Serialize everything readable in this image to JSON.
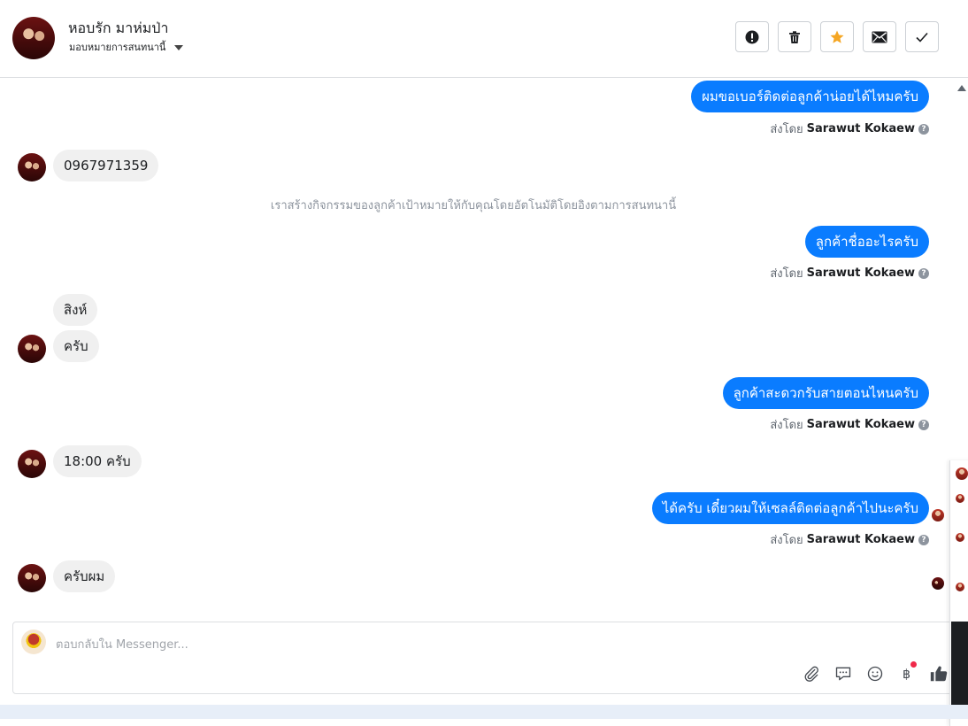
{
  "header": {
    "contact_name": "หอบรัก มาห่มป่า",
    "assign_label": "มอบหมายการสนทนานี้",
    "actions": [
      {
        "icon": "exclamation-icon"
      },
      {
        "icon": "trash-icon"
      },
      {
        "icon": "star-icon",
        "color": "#f5a623"
      },
      {
        "icon": "envelope-icon"
      },
      {
        "icon": "check-icon"
      }
    ]
  },
  "sent_by_prefix": "ส่งโดย",
  "agent_name": "Sarawut Kokaew",
  "messages": [
    {
      "direction": "out",
      "text": "ผมขอเบอร์ติดต่อลูกค้าน่อยได้ไหมครับ"
    },
    {
      "direction": "in",
      "text": "0967971359"
    },
    {
      "direction": "system",
      "text": "เราสร้างกิจกรรมของลูกค้าเป้าหมายให้กับคุณโดยอัตโนมัติโดยอิงตามการสนทนานี้"
    },
    {
      "direction": "out",
      "text": "ลูกค้าชื่ออะไรครับ"
    },
    {
      "direction": "in",
      "text": "สิงห์"
    },
    {
      "direction": "in",
      "text": "ครับ"
    },
    {
      "direction": "out",
      "text": "ลูกค้าสะดวกรับสายตอนไหนครับ"
    },
    {
      "direction": "in",
      "text": "18:00 ครับ"
    },
    {
      "direction": "out",
      "text": "ได้ครับ เดี๋ยวผมให้เซลล์ติดต่อลูกค้าไปนะครับ"
    },
    {
      "direction": "in",
      "text": "ครับผม"
    }
  ],
  "compose": {
    "placeholder": "ตอบกลับใน Messenger...",
    "tools": [
      "paperclip-icon",
      "speech-bubble-icon",
      "smiley-icon",
      "baht-icon",
      "thumbs-up-icon"
    ]
  },
  "colors": {
    "outgoing_bubble": "#0a7cff",
    "incoming_bubble": "#f0f0f0",
    "accent_star": "#f5a623"
  }
}
